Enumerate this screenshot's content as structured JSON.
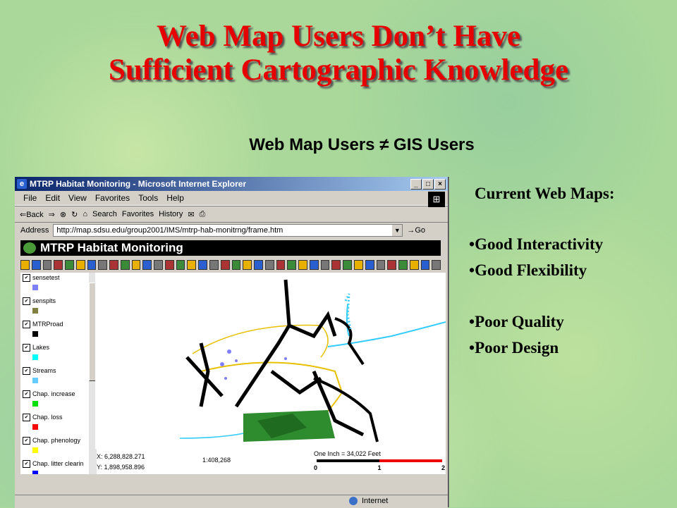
{
  "slide": {
    "title_line1": "Web Map Users Don’t Have",
    "title_line2": "Sufficient Cartographic Knowledge",
    "subtitle": "Web Map Users ≠ GIS Users",
    "list_heading": "Current Web Maps:",
    "list_group1": [
      "Good Interactivity",
      "Good Flexibility"
    ],
    "list_group2": [
      "Poor Quality",
      "Poor Design"
    ]
  },
  "browser": {
    "window_title": "MTRP Habitat Monitoring - Microsoft Internet Explorer",
    "menu": [
      "File",
      "Edit",
      "View",
      "Favorites",
      "Tools",
      "Help"
    ],
    "toolbar": {
      "back": "⇐Back",
      "forward": "⇒",
      "search": "Search",
      "favorites": "Favorites",
      "history": "History"
    },
    "address_label": "Address",
    "address_value": "http://map.sdsu.edu/group2001/IMS/mtrp-hab-monitrng/frame.htm",
    "go_label": "Go",
    "status_zone": "Internet"
  },
  "app": {
    "title": "MTRP Habitat Monitoring",
    "layers": [
      {
        "name": "sensetest",
        "color": "#8080ff"
      },
      {
        "name": "sensplts",
        "color": "#808040"
      },
      {
        "name": "MTRProad",
        "color": "#000000"
      },
      {
        "name": "Lakes",
        "color": "#00ffff"
      },
      {
        "name": "Streams",
        "color": "#66ccff"
      },
      {
        "name": "Chap. increase",
        "color": "#00e000"
      },
      {
        "name": "Chap. loss",
        "color": "#ff0000"
      },
      {
        "name": "Chap. phenology",
        "color": "#ffff00"
      },
      {
        "name": "Chap. litter clearin",
        "color": "#0000ff"
      }
    ],
    "coord_x": "X: 6,288,828.271",
    "coord_y": "Y: 1,898,958.896",
    "scale": "1:408,268",
    "scale_text": "One Inch = 34,022 Feet",
    "scale_ticks": [
      "0",
      "1",
      "2"
    ]
  },
  "colors": {
    "title": "#e60000",
    "background": "#a9d89a"
  }
}
